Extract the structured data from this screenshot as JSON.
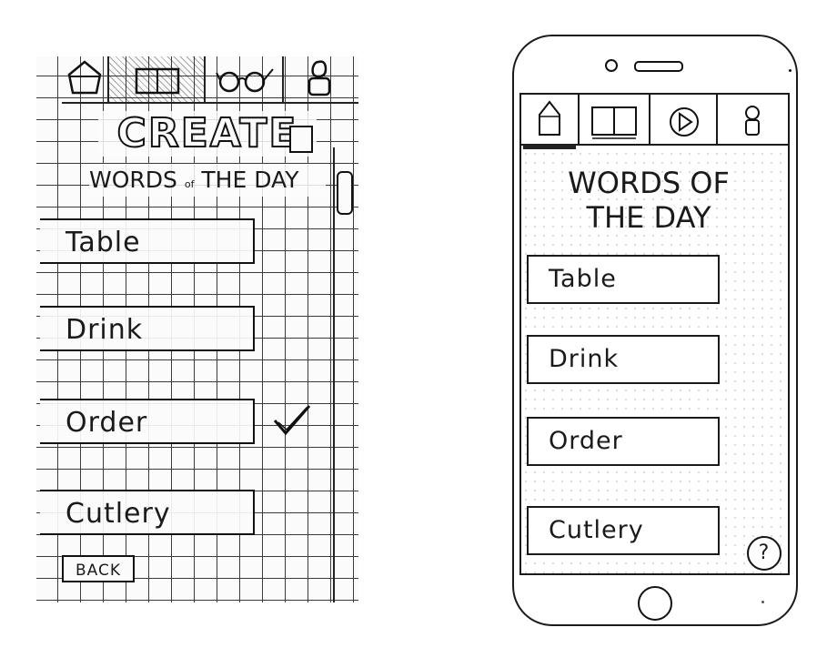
{
  "sketch": {
    "tabs": [
      {
        "icon": "home-icon"
      },
      {
        "icon": "book-icon"
      },
      {
        "icon": "glasses-icon"
      },
      {
        "icon": "profile-icon"
      }
    ],
    "title": "CREATE",
    "subtitle_part1": "WORDS",
    "subtitle_small": "of",
    "subtitle_part2": "THE DAY",
    "words": [
      "Table",
      "Drink",
      "Order",
      "Cutlery"
    ],
    "selected_word": "Order",
    "back_label": "BACK"
  },
  "phone": {
    "tabs": [
      {
        "icon": "home-icon"
      },
      {
        "icon": "book-icon"
      },
      {
        "icon": "play-icon"
      },
      {
        "icon": "profile-icon"
      }
    ],
    "title_line1": "WORDS OF",
    "title_line2": "THE DAY",
    "words": [
      "Table",
      "Drink",
      "Order",
      "Cutlery"
    ],
    "help_label": "?"
  }
}
